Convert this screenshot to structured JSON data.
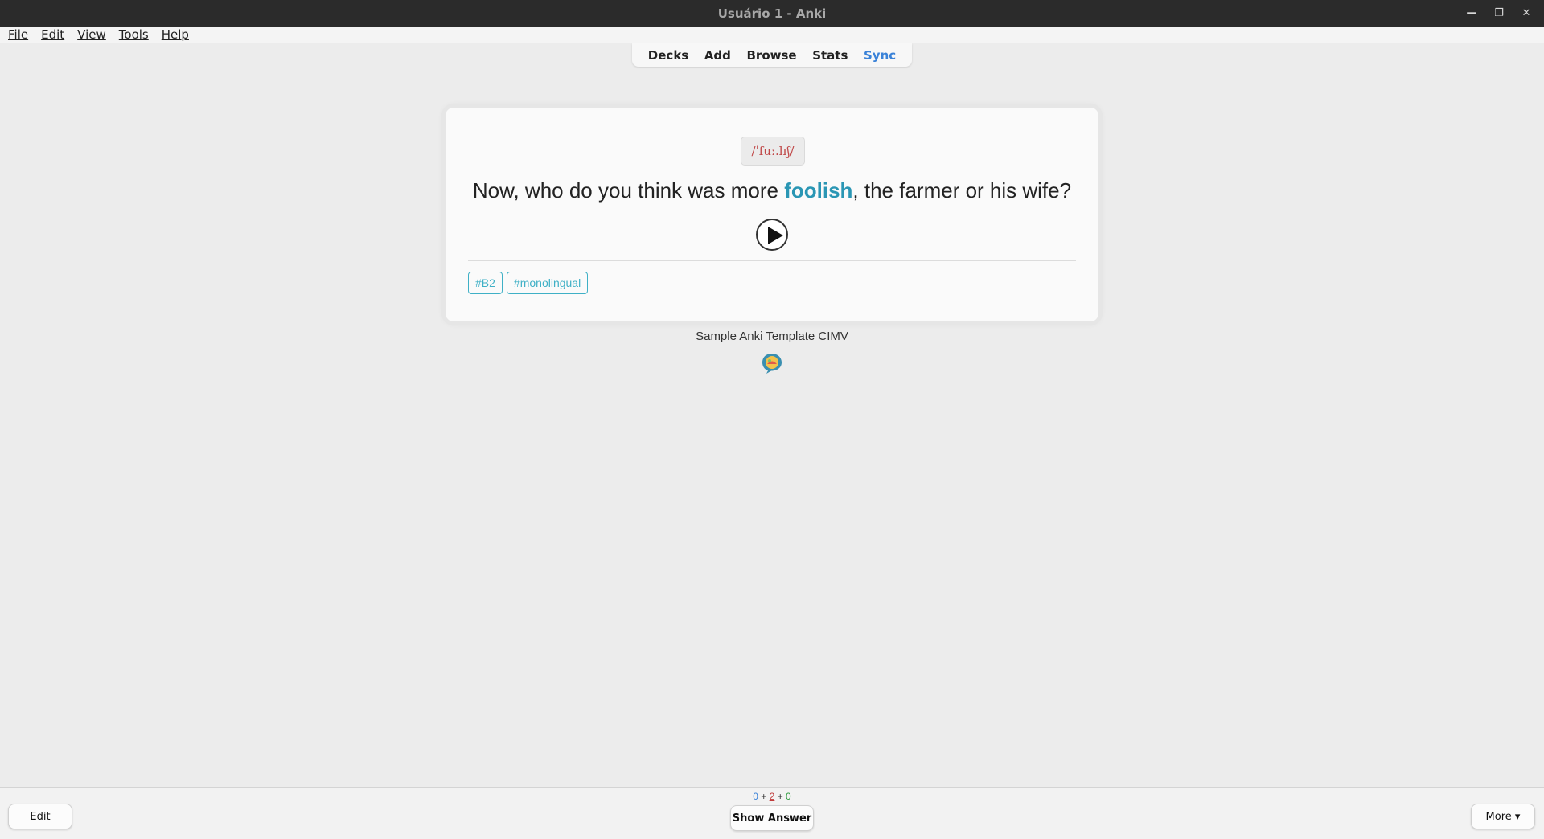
{
  "window": {
    "title": "Usuário 1 - Anki",
    "controls": [
      "minimize-icon",
      "restore-icon",
      "close-icon"
    ]
  },
  "menu": {
    "items": [
      {
        "label": "File",
        "mnemonic": "F"
      },
      {
        "label": "Edit",
        "mnemonic": "E"
      },
      {
        "label": "View",
        "mnemonic": "V"
      },
      {
        "label": "Tools",
        "mnemonic": "T"
      },
      {
        "label": "Help",
        "mnemonic": "H"
      }
    ]
  },
  "toolbar": {
    "decks": "Decks",
    "add": "Add",
    "browse": "Browse",
    "stats": "Stats",
    "sync": "Sync",
    "sync_color": "#3a82d8"
  },
  "card": {
    "ipa": "/ˈfuː.lɪʃ/",
    "sentence_before": "Now, who do you think was more ",
    "keyword": "foolish",
    "sentence_after": ", the farmer or his wife?",
    "keyword_color": "#2a96b4",
    "audio_icon": "play-icon",
    "tags": [
      "#B2",
      "#monolingual"
    ],
    "tag_color": "#3fb0c6"
  },
  "footer": {
    "template_name": "Sample Anki Template CIMV",
    "logo_icon": "speech-bubble-logo-icon"
  },
  "bottombar": {
    "edit": "Edit",
    "show_answer": "Show Answer",
    "more": "More ▾",
    "counts": {
      "new": "0",
      "learning": "2",
      "review": "0",
      "sep": "+"
    }
  }
}
